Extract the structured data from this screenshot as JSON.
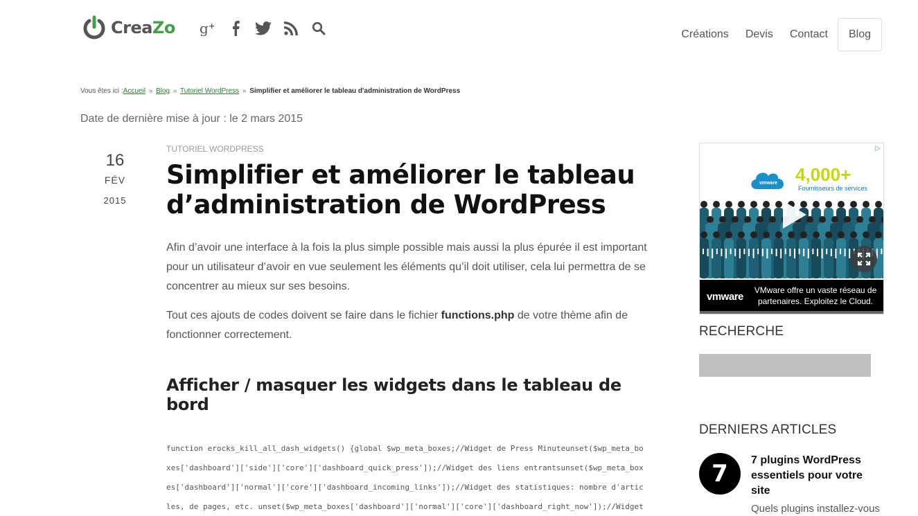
{
  "header": {
    "logo_text_1": "Crea",
    "logo_text_2": "Zo",
    "social": [
      "google-plus-icon",
      "facebook-icon",
      "twitter-icon",
      "rss-icon",
      "search-icon"
    ],
    "nav": [
      {
        "label": "Créations"
      },
      {
        "label": "Devis"
      },
      {
        "label": "Contact"
      },
      {
        "label": "Blog",
        "active": true
      }
    ]
  },
  "breadcrumb": {
    "prefix": "Vous êtes ici :",
    "items": [
      "Accueil",
      "Blog",
      "Tutoriel WordPress"
    ],
    "separator": "»",
    "current": "Simplifier et améliorer le tableau d'administration de WordPress"
  },
  "updated": "Date de dernière mise à jour : le 2 mars 2015",
  "post_date": {
    "day": "16",
    "month": "FÉV",
    "year": "2015"
  },
  "article": {
    "category": "TUTORIEL WORDPRESS",
    "title": "Simplifier et améliorer le tableau d’administration de WordPress",
    "paragraph1": "Afin d’avoir une interface à la fois la plus simple possible mais aussi la plus épurée il est important pour un utilisateur d’avoir en vue seulement les éléments qu’il doit utiliser, cela lui permettra de se concentrer au mieux sur ses besoins.",
    "paragraph2_before": "Tout ces ajouts de codes doivent se faire dans le fichier ",
    "paragraph2_bold": "functions.php",
    "paragraph2_after": " de votre thème afin de fonctionner correctement.",
    "heading": "Afficher / masquer les widgets dans le tableau de bord",
    "code": "function erocks_kill_all_dash_widgets() {global $wp_meta_boxes;//Widget de Press Minuteunset($wp_meta_boxes['dashboard']['side']['core']['dashboard_quick_press']);//Widget des liens entrantsunset($wp_meta_boxes['dashboard']['normal']['core']['dashboard_incoming_links']);//Widget des statistiques: nombre d'articles, de pages, etc. unset($wp_meta_boxes['dashboard']['normal']['core']['dashboard_right_now']);//Widget des news sur les plugins WordPressunset($wp_meta_boxes['dashboard']["
  },
  "ad": {
    "big_number": "4,000+",
    "small_text": "Fournisseurs de services",
    "brand": "vmware",
    "message": "VMware offre un vaste réseau de partenaires. Exploitez le Cloud."
  },
  "sidebar": {
    "search_title": "RECHERCHE",
    "recent_title": "DERNIERS ARTICLES",
    "recent": [
      {
        "number": "7",
        "title": "7 plugins WordPress essentiels pour votre site",
        "excerpt": "Quels plugins installez-vous"
      }
    ]
  },
  "colors": {
    "accent": "#43a047",
    "text": "#333333"
  }
}
